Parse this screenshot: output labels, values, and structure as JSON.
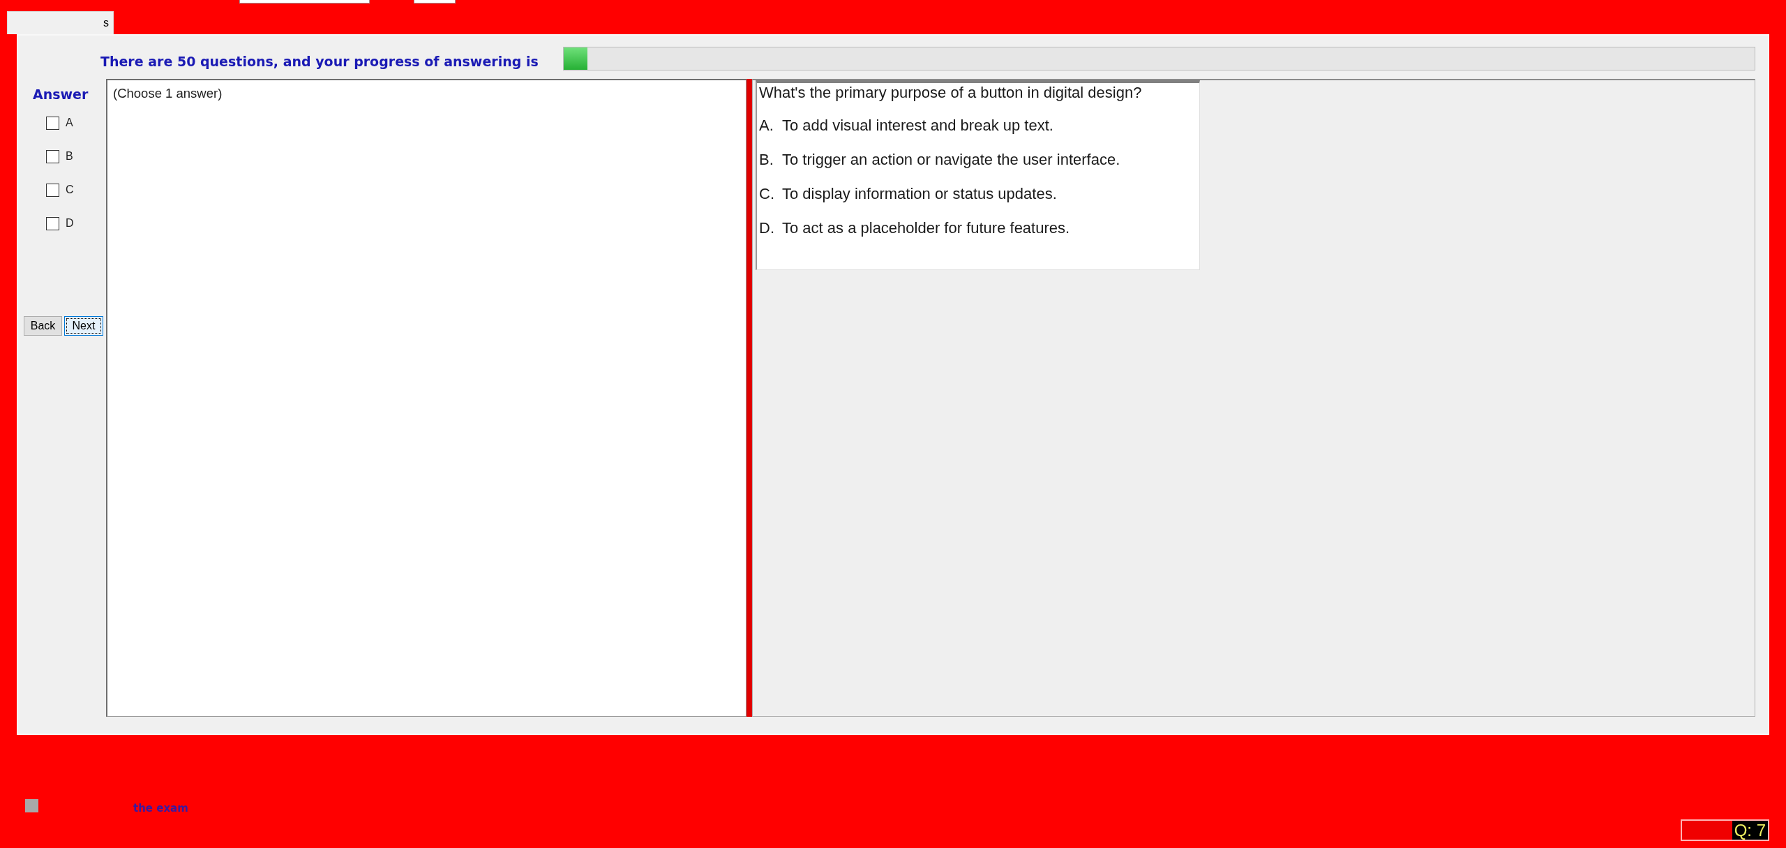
{
  "tabs": [
    {
      "label": "s",
      "selected": true
    }
  ],
  "progress": {
    "label": "There are 50 questions, and your progress of answering is",
    "level": 0.02
  },
  "answer_panel": {
    "title": "Answer",
    "options": [
      {
        "label": "A",
        "checked": false
      },
      {
        "label": "B",
        "checked": false
      },
      {
        "label": "C",
        "checked": false
      },
      {
        "label": "D",
        "checked": false
      }
    ]
  },
  "buttons": [
    {
      "label": "Back",
      "focused": false
    },
    {
      "label": "Next",
      "focused": true
    }
  ],
  "instructions": "(Choose 1 answer)",
  "question": {
    "text": "What's the primary purpose of a button in digital design?",
    "options": [
      {
        "letter": "A.",
        "text": "To add visual interest and break up text."
      },
      {
        "letter": "B.",
        "text": "To trigger an action or navigate the user interface."
      },
      {
        "letter": "C.",
        "text": "To display information or status updates."
      },
      {
        "letter": "D.",
        "text": "To act as a placeholder for future features."
      }
    ]
  },
  "finish_checkbox": {
    "label": "the exam",
    "disabled": true
  },
  "question_counter": "Q: 7"
}
